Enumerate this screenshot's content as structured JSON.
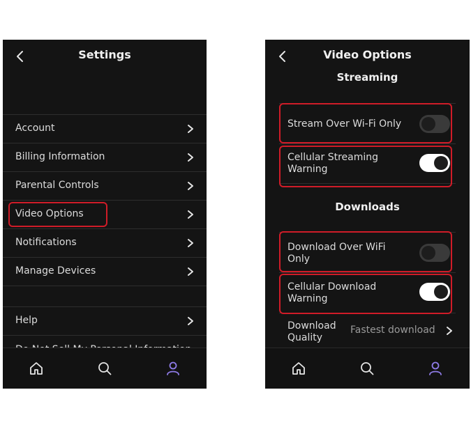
{
  "settings": {
    "title": "Settings",
    "items": [
      {
        "label": "Account"
      },
      {
        "label": "Billing Information"
      },
      {
        "label": "Parental Controls"
      },
      {
        "label": "Video Options"
      },
      {
        "label": "Notifications"
      },
      {
        "label": "Manage Devices"
      }
    ],
    "items_secondary": [
      {
        "label": "Help"
      },
      {
        "label": "Do Not Sell My Personal Information"
      }
    ]
  },
  "video_options": {
    "title": "Video Options",
    "streaming_header": "Streaming",
    "streaming": [
      {
        "label": "Stream Over Wi-Fi Only",
        "enabled": false
      },
      {
        "label_line1": "Cellular Streaming",
        "label_line2": "Warning",
        "enabled": true
      }
    ],
    "downloads_header": "Downloads",
    "downloads": [
      {
        "label_line1": "Download Over WiFi",
        "label_line2": "Only",
        "enabled": false
      },
      {
        "label_line1": "Cellular Download",
        "label_line2": "Warning",
        "enabled": true
      }
    ],
    "quality": {
      "label_line1": "Download",
      "label_line2": "Quality",
      "value": "Fastest download"
    }
  },
  "navbar": {
    "icons": [
      "home-icon",
      "search-icon",
      "profile-icon"
    ],
    "active": "profile-icon",
    "active_color": "#8f7ce8"
  },
  "colors": {
    "highlight": "#d01c28",
    "background": "#141414"
  }
}
